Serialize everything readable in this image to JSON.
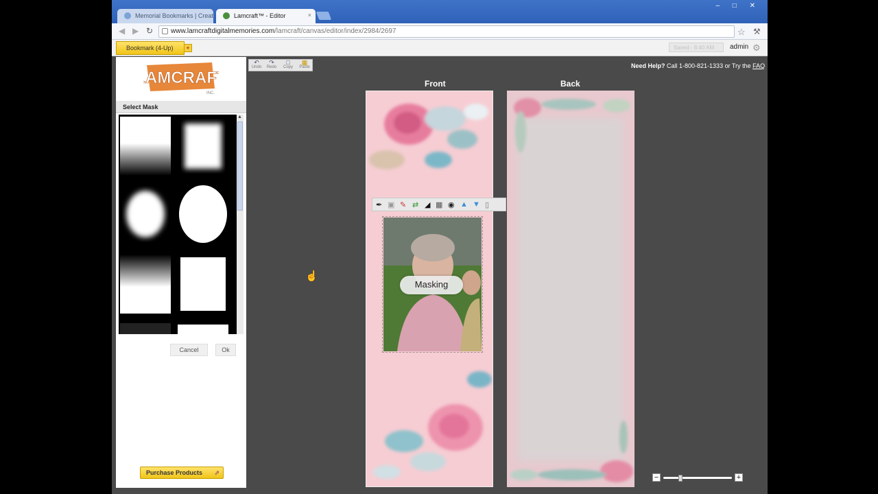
{
  "browser": {
    "tabs": [
      {
        "title": "Memorial Bookmarks | Create"
      },
      {
        "title": "Lamcraft™ - Editor"
      }
    ],
    "tab_close": "×",
    "window_controls": "‒ □ ✕",
    "url_host": "www.lamcraftdigitalmemories.com",
    "url_path": "/lamcraft/canvas/editor/index/2984/2697",
    "icons": [
      "back-icon",
      "forward-icon",
      "reload-icon",
      "star-icon",
      "wrench-icon"
    ]
  },
  "appbar": {
    "project_tab": "Bookmark (4-Up)",
    "add_tab": "+",
    "saved": "Saved - 8:40 AM",
    "user": "admin"
  },
  "left_panel": {
    "logo_text": "LAMCRAFT",
    "logo_sub": "INC.",
    "heading": "Select Mask",
    "cancel_label": "Cancel",
    "ok_label": "Ok",
    "purchase_label": "Purchase Products"
  },
  "toolbar": {
    "undo": "Undo",
    "redo": "Redo",
    "copy": "Copy",
    "paste": "Paste"
  },
  "help": {
    "prefix": "Need Help?",
    "text": " Call 1-800-821-1333 or Try the ",
    "link": "FAQ"
  },
  "canvas": {
    "front_label": "Front",
    "back_label": "Back",
    "status_overlay": "Masking"
  },
  "colors": {
    "accent_yellow": "#f0c418",
    "chrome_blue": "#3f73c8",
    "workspace": "#4a4a4a",
    "card_pink": "#f6cdd3"
  }
}
